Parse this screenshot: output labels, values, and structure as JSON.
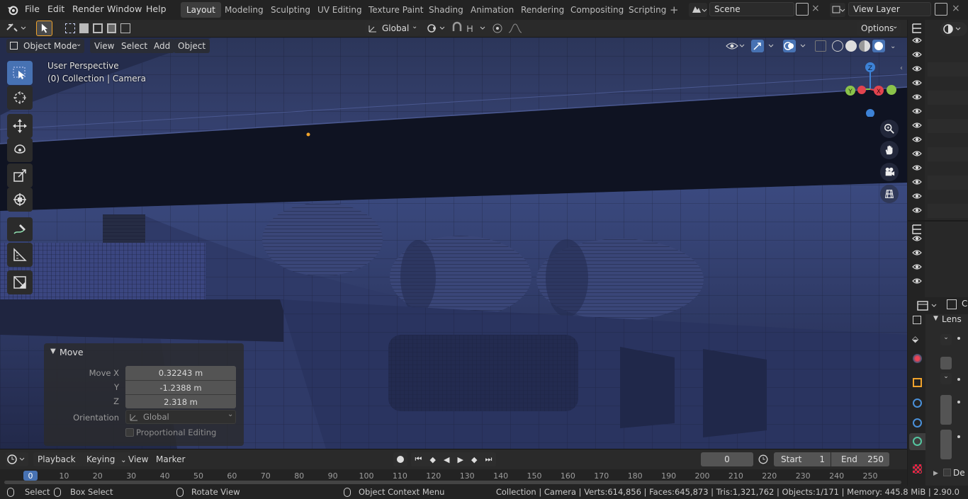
{
  "topbar": {
    "menus": [
      "File",
      "Edit",
      "Render",
      "Window",
      "Help"
    ],
    "workspaces": [
      "Layout",
      "Modeling",
      "Sculpting",
      "UV Editing",
      "Texture Paint",
      "Shading",
      "Animation",
      "Rendering",
      "Compositing",
      "Scripting"
    ],
    "active_workspace": "Layout",
    "scene": "Scene",
    "view_layer": "View Layer"
  },
  "toolheader": {
    "orientation": "Global",
    "options": "Options"
  },
  "viewport": {
    "mode": "Object Mode",
    "menus": [
      "View",
      "Select",
      "Add",
      "Object"
    ],
    "perspective": "User Perspective",
    "collection_info": "(0) Collection | Camera",
    "gizmo": {
      "x": "X",
      "y": "Y",
      "z": "Z"
    }
  },
  "move_panel": {
    "title": "Move",
    "move_x_label": "Move X",
    "y_label": "Y",
    "z_label": "Z",
    "x_value": "0.32243 m",
    "y_value": "-1.2388 m",
    "z_value": "2.318 m",
    "orientation_label": "Orientation",
    "orientation_value": "Global",
    "proportional_label": "Proportional Editing"
  },
  "timeline": {
    "menus": [
      "Playback",
      "Keying",
      "View",
      "Marker"
    ],
    "current_frame": "0",
    "start_label": "Start",
    "start_value": "1",
    "end_label": "End",
    "end_value": "250",
    "ticks": [
      "0",
      "10",
      "20",
      "30",
      "40",
      "50",
      "60",
      "70",
      "80",
      "90",
      "100",
      "110",
      "120",
      "130",
      "140",
      "150",
      "160",
      "170",
      "180",
      "190",
      "200",
      "210",
      "220",
      "230",
      "240",
      "250"
    ]
  },
  "statusbar": {
    "select": "Select",
    "box_select": "Box Select",
    "rotate_view": "Rotate View",
    "context_menu": "Object Context Menu",
    "stats": "Collection | Camera | Verts:614,856 | Faces:645,873 | Tris:1,321,762 | Objects:1/171 | Memory: 445.8 MiB | 2.90.0"
  },
  "properties": {
    "lens_label": "Lens",
    "tab_partial": "C",
    "de_partial": "De"
  },
  "colors": {
    "accent": "#4772b3",
    "viewport_bg": "#1f2742",
    "x_axis": "#e2444f",
    "y_axis": "#8bc34a",
    "z_axis": "#3d82d6"
  }
}
